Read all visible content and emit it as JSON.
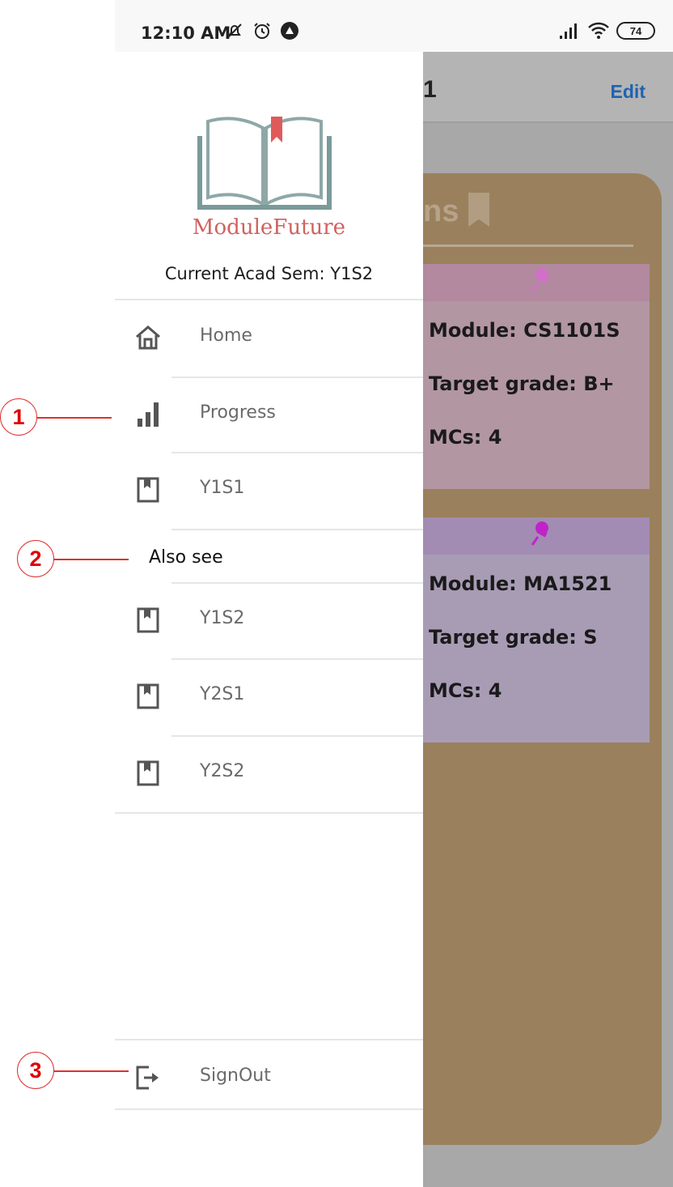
{
  "status_bar": {
    "time": "12:10 AM",
    "battery": "74"
  },
  "background_app": {
    "title_fragment": "1",
    "edit_label": "Edit",
    "section_heading_fragment": "ns",
    "cards": [
      {
        "module": "Module: CS1101S",
        "target": "Target grade: B+",
        "mcs": "MCs: 4",
        "color": "#b296a2",
        "top_color": "#b3899f",
        "pin_color": "#d070c8"
      },
      {
        "module": "Module: MA1521",
        "target": "Target grade: S",
        "mcs": "MCs: 4",
        "color": "#a89cb5",
        "top_color": "#a28cb3",
        "pin_color": "#c024c8"
      }
    ]
  },
  "drawer": {
    "logo_text": "ModuleFuture",
    "current_sem": "Current Acad Sem: Y1S2",
    "items": [
      {
        "label": "Home",
        "icon": "home-icon"
      },
      {
        "label": "Progress",
        "icon": "bar-chart-icon"
      },
      {
        "label": "Y1S1",
        "icon": "bookmark-icon"
      }
    ],
    "also_see_label": "Also see",
    "other_items": [
      {
        "label": "Y1S2",
        "icon": "bookmark-icon"
      },
      {
        "label": "Y2S1",
        "icon": "bookmark-icon"
      },
      {
        "label": "Y2S2",
        "icon": "bookmark-icon"
      }
    ],
    "signout_label": "SignOut"
  },
  "callouts": [
    "1",
    "2",
    "3"
  ],
  "colors": {
    "logo_red": "#d0625f",
    "accent_blue": "#1e63b0",
    "callout_red": "#e00000",
    "board_brown": "#9a805c"
  }
}
